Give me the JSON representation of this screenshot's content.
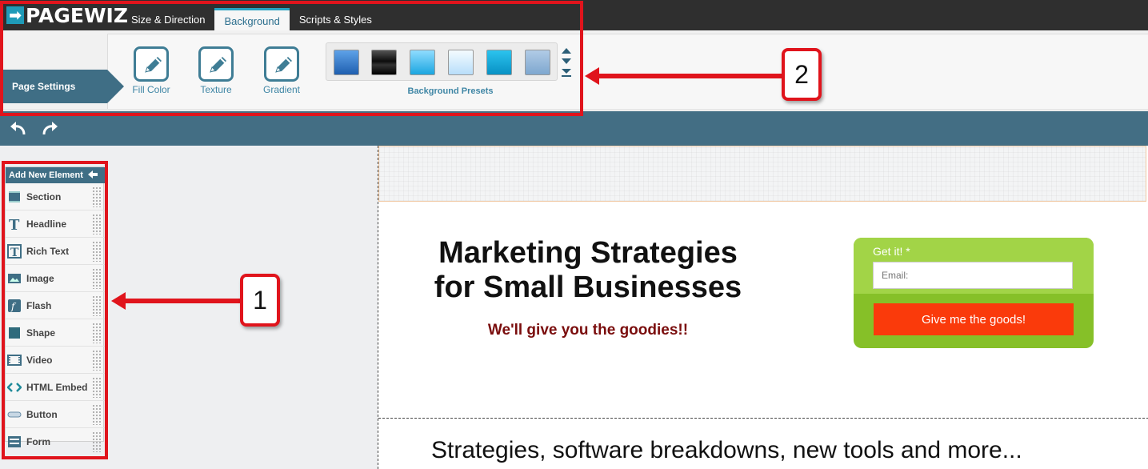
{
  "app": {
    "logo_text": "PAGEWIZ",
    "logo_mark": "➡"
  },
  "tabs": [
    {
      "label": "Size & Direction",
      "active": false
    },
    {
      "label": "Background",
      "active": true
    },
    {
      "label": "Scripts & Styles",
      "active": false
    }
  ],
  "toolbar": {
    "section_label": "Page Settings",
    "tools": [
      {
        "label": "Fill Color",
        "icon": "pencil-edit-icon"
      },
      {
        "label": "Texture",
        "icon": "pencil-edit-icon"
      },
      {
        "label": "Gradient",
        "icon": "pencil-edit-icon"
      }
    ],
    "presets_label": "Background Presets",
    "presets": [
      {
        "name": "blue-gloss",
        "color": "#3a7fd0"
      },
      {
        "name": "black-gloss",
        "color": "#1b1b1b"
      },
      {
        "name": "sky-blue",
        "color": "#33b7e9"
      },
      {
        "name": "pale-blue",
        "color": "#cfeafc"
      },
      {
        "name": "cyan",
        "color": "#15a9d9"
      },
      {
        "name": "steel-blue",
        "color": "#8db2d6"
      }
    ]
  },
  "history": {
    "undo_icon": "undo-icon",
    "redo_icon": "redo-icon"
  },
  "elements_panel": {
    "title": "Add New Element",
    "items": [
      {
        "label": "Section",
        "icon": "section-icon"
      },
      {
        "label": "Headline",
        "icon": "headline-icon"
      },
      {
        "label": "Rich Text",
        "icon": "rich-text-icon"
      },
      {
        "label": "Image",
        "icon": "image-icon"
      },
      {
        "label": "Flash",
        "icon": "flash-icon"
      },
      {
        "label": "Shape",
        "icon": "shape-icon"
      },
      {
        "label": "Video",
        "icon": "video-icon"
      },
      {
        "label": "HTML Embed",
        "icon": "html-embed-icon"
      },
      {
        "label": "Button",
        "icon": "button-icon"
      },
      {
        "label": "Form",
        "icon": "form-icon"
      }
    ]
  },
  "canvas": {
    "headline": "Marketing Strategies for Small Businesses",
    "subheadline": "We'll give you the goodies!!",
    "form": {
      "label": "Get it! *",
      "email_placeholder": "Email:",
      "submit_label": "Give me the goods!"
    },
    "tagline": "Strategies, software breakdowns, new tools and more..."
  },
  "annotations": {
    "callout_1": "1",
    "callout_2": "2",
    "color": "#e0141c"
  },
  "colors": {
    "brand_teal": "#1f9bb8",
    "header_dark": "#2f2f2f",
    "panel_blue": "#3f6e85",
    "form_green": "#86c028",
    "cta_red": "#fa3a0b"
  }
}
